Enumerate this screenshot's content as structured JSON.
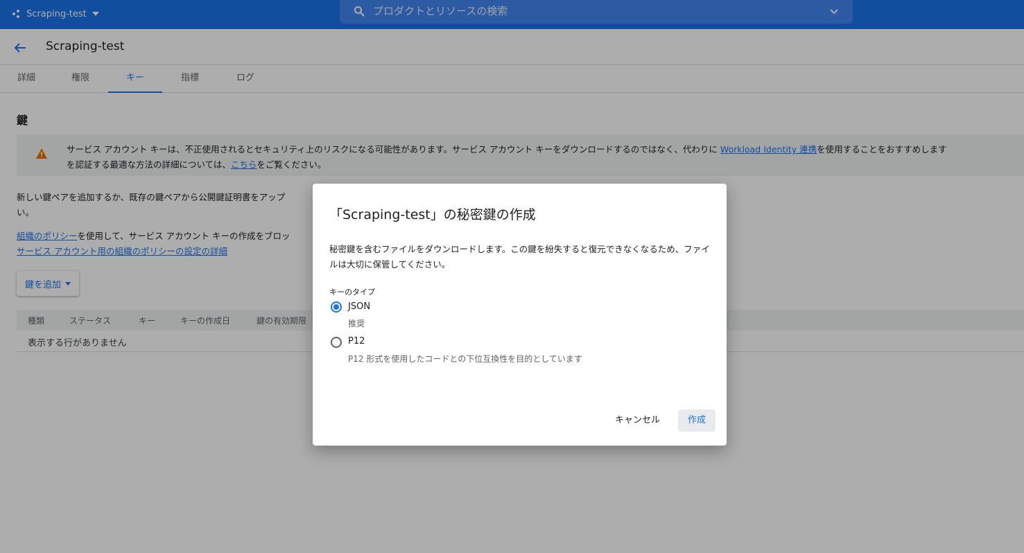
{
  "topbar": {
    "project_name": "Scraping-test",
    "search_placeholder": "プロダクトとリソースの検索"
  },
  "header": {
    "title": "Scraping-test"
  },
  "tabs": [
    {
      "label": "詳細"
    },
    {
      "label": "権限"
    },
    {
      "label": "キー",
      "active": true
    },
    {
      "label": "指標"
    },
    {
      "label": "ログ"
    }
  ],
  "content": {
    "section_title": "鍵",
    "warning": {
      "line1_pre": "サービス アカウント キーは、不正使用されるとセキュリティ上のリスクになる可能性があります。サービス アカウント キーをダウンロードするのではなく、代わりに ",
      "line1_link": "Workload Identity 連携",
      "line1_post": "を使用することをおすすめします",
      "line2_pre": "を認証する最適な方法の詳細については、",
      "line2_link": "こちら",
      "line2_post": "をご覧ください。"
    },
    "para1_line1": "新しい鍵ペアを追加するか、既存の鍵ペアから公開鍵証明書をアップ",
    "para1_line2": "い。",
    "para2_link1": "組織のポリシー",
    "para2_text": "を使用して、サービス アカウント キーの作成をブロッ",
    "para2_link2": "サービス アカウント用の組織のポリシーの設定の詳細",
    "add_key_label": "鍵を追加",
    "table": {
      "columns": [
        "種類",
        "ステータス",
        "キー",
        "キーの作成日",
        "鍵の有効期限"
      ],
      "empty_text": "表示する行がありません"
    }
  },
  "dialog": {
    "title": "「Scraping-test」の秘密鍵の作成",
    "description": "秘密鍵を含むファイルをダウンロードします。この鍵を紛失すると復元できなくなるため、ファイルは大切に保管してください。",
    "key_type_label": "キーのタイプ",
    "options": [
      {
        "label": "JSON",
        "sub": "推奨",
        "selected": true
      },
      {
        "label": "P12",
        "sub": "P12 形式を使用したコードとの下位互換性を目的としています",
        "selected": false
      }
    ],
    "cancel_label": "キャンセル",
    "create_label": "作成"
  },
  "colors": {
    "brand_blue": "#1a73e8",
    "warning_orange": "#e37400"
  }
}
